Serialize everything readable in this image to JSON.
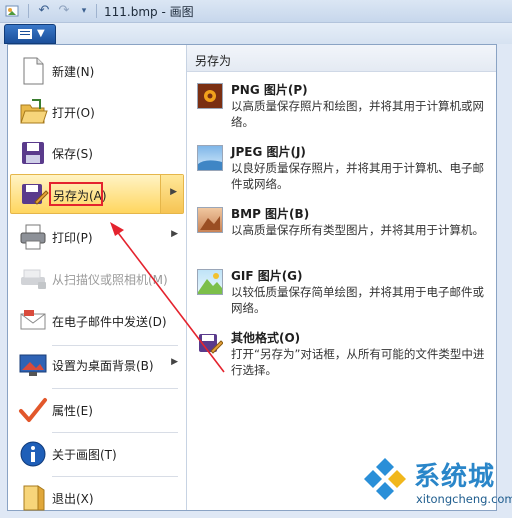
{
  "window": {
    "title": "111.bmp - 画图"
  },
  "quick_access": {
    "icons": [
      "paint-app-icon",
      "undo-icon",
      "redo-icon",
      "customize-dropdown-icon"
    ]
  },
  "menu": {
    "items": [
      {
        "label": "新建(N)",
        "icon": "new-file-icon",
        "enabled": true,
        "submenu": false
      },
      {
        "label": "打开(O)",
        "icon": "open-folder-icon",
        "enabled": true,
        "submenu": false
      },
      {
        "label": "保存(S)",
        "icon": "save-icon",
        "enabled": true,
        "submenu": false
      },
      {
        "label": "另存为(A)",
        "icon": "save-as-icon",
        "enabled": true,
        "submenu": true,
        "highlighted": true
      },
      {
        "label": "打印(P)",
        "icon": "printer-icon",
        "enabled": true,
        "submenu": true
      },
      {
        "label": "从扫描仪或照相机(M)",
        "icon": "scanner-icon",
        "enabled": false,
        "submenu": false
      },
      {
        "label": "在电子邮件中发送(D)",
        "icon": "email-icon",
        "enabled": true,
        "submenu": false
      },
      {
        "label": "设置为桌面背景(B)",
        "icon": "desktop-background-icon",
        "enabled": true,
        "submenu": true
      },
      {
        "label": "属性(E)",
        "icon": "properties-check-icon",
        "enabled": true,
        "submenu": false
      },
      {
        "label": "关于画图(T)",
        "icon": "info-icon",
        "enabled": true,
        "submenu": false
      },
      {
        "label": "退出(X)",
        "icon": "exit-icon",
        "enabled": true,
        "submenu": false
      }
    ]
  },
  "save_as_panel": {
    "heading": "另存为",
    "formats": [
      {
        "name": "PNG 图片(P)",
        "desc": "以高质量保存照片和绘图，并将其用于计算机或网络。",
        "icon": "png-image-icon"
      },
      {
        "name": "JPEG 图片(J)",
        "desc": "以良好质量保存照片，并将其用于计算机、电子邮件或网络。",
        "icon": "jpeg-image-icon"
      },
      {
        "name": "BMP 图片(B)",
        "desc": "以高质量保存所有类型图片，并将其用于计算机。",
        "icon": "bmp-image-icon"
      },
      {
        "name": "GIF 图片(G)",
        "desc": "以较低质量保存简单绘图，并将其用于电子邮件或网络。",
        "icon": "gif-image-icon"
      },
      {
        "name": "其他格式(O)",
        "desc": "打开“另存为”对话框，从所有可能的文件类型中进行选择。",
        "icon": "other-formats-icon"
      }
    ]
  },
  "watermark": {
    "brand": "系统城",
    "url": "xitongcheng.com"
  },
  "colors": {
    "highlight": "#ffd65f",
    "annotation": "#e4232e",
    "app_button": "#2a62b0"
  }
}
